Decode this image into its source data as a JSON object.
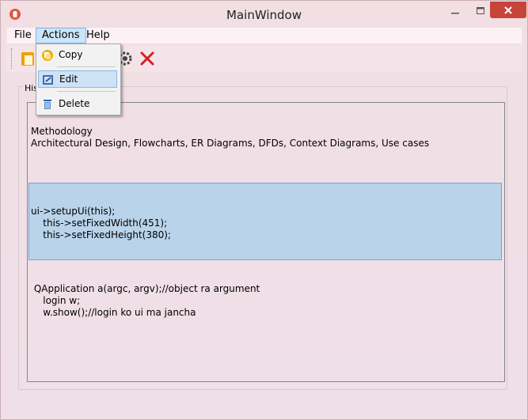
{
  "window": {
    "title": "MainWindow"
  },
  "menubar": {
    "file": "File",
    "actions": "Actions",
    "help": "Help"
  },
  "actions_menu": {
    "copy": "Copy",
    "edit": "Edit",
    "delete": "Delete"
  },
  "group": {
    "label": "His"
  },
  "list": {
    "items": [
      "Methodology\nArchitectural Design, Flowcharts, ER Diagrams, DFDs, Context Diagrams, Use cases",
      "ui->setupUi(this);\n    this->setFixedWidth(451);\n    this->setFixedHeight(380);",
      " QApplication a(argc, argv);//object ra argument\n    login w;\n    w.show();//login ko ui ma jancha"
    ],
    "selected_index": 1
  },
  "colors": {
    "close_button": "#c7443a",
    "selection_bg": "#b9d3ea",
    "selection_border": "#6fa6d6",
    "menu_highlight": "#cce4f7"
  },
  "icons": {
    "app": "app-icon",
    "copy": "copy-icon",
    "edit": "edit-icon",
    "delete": "trash-icon",
    "toolbar_paste": "paste-icon",
    "toolbar_settings": "gear-icon",
    "toolbar_cancel": "red-x-icon"
  }
}
